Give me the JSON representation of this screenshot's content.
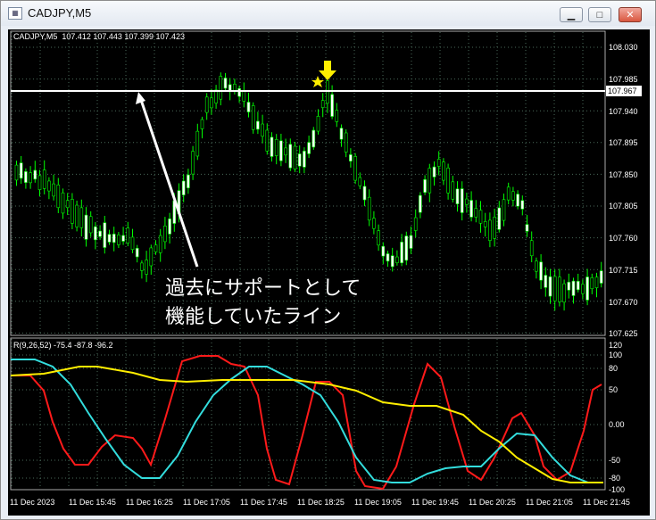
{
  "window": {
    "title": "CADJPY,M5",
    "icon": "chart-window-icon",
    "buttons": {
      "minimize": "▁",
      "maximize": "□",
      "close": "✕"
    }
  },
  "main_pane": {
    "header": "CADJPY,M5  107.412 107.443 107.399 107.423",
    "price_axis": [
      "108.030",
      "107.985",
      "107.940",
      "107.895",
      "107.850",
      "107.805",
      "107.760",
      "107.715",
      "107.670",
      "107.625"
    ],
    "current_line_price": "107.967",
    "annotation_line1": "過去にサポートとして",
    "annotation_line2": "機能していたライン",
    "markers": [
      "down-arrow-icon",
      "star-icon"
    ]
  },
  "indicator_pane": {
    "header": "R(9,26,52) -75.4 -87.8 -96.2",
    "axis": [
      "120",
      "100",
      "80",
      "50",
      "0.00",
      "-50",
      "-80",
      "-100"
    ]
  },
  "time_axis": [
    "11 Dec 2023",
    "11 Dec 15:45",
    "11 Dec 16:25",
    "11 Dec 17:05",
    "11 Dec 17:45",
    "11 Dec 18:25",
    "11 Dec 19:05",
    "11 Dec 19:45",
    "11 Dec 20:25",
    "11 Dec 21:05",
    "11 Dec 21:45"
  ],
  "colors": {
    "bull_candle": "#ffffff",
    "bear_candle": "#000000",
    "wick": "#00ff00",
    "grid": "#4a6a5a",
    "hline": "#ffffff",
    "marker": "#ffee00",
    "osc_red": "#ff1a1a",
    "osc_cyan": "#33dddd",
    "osc_yellow": "#ffee00"
  }
}
